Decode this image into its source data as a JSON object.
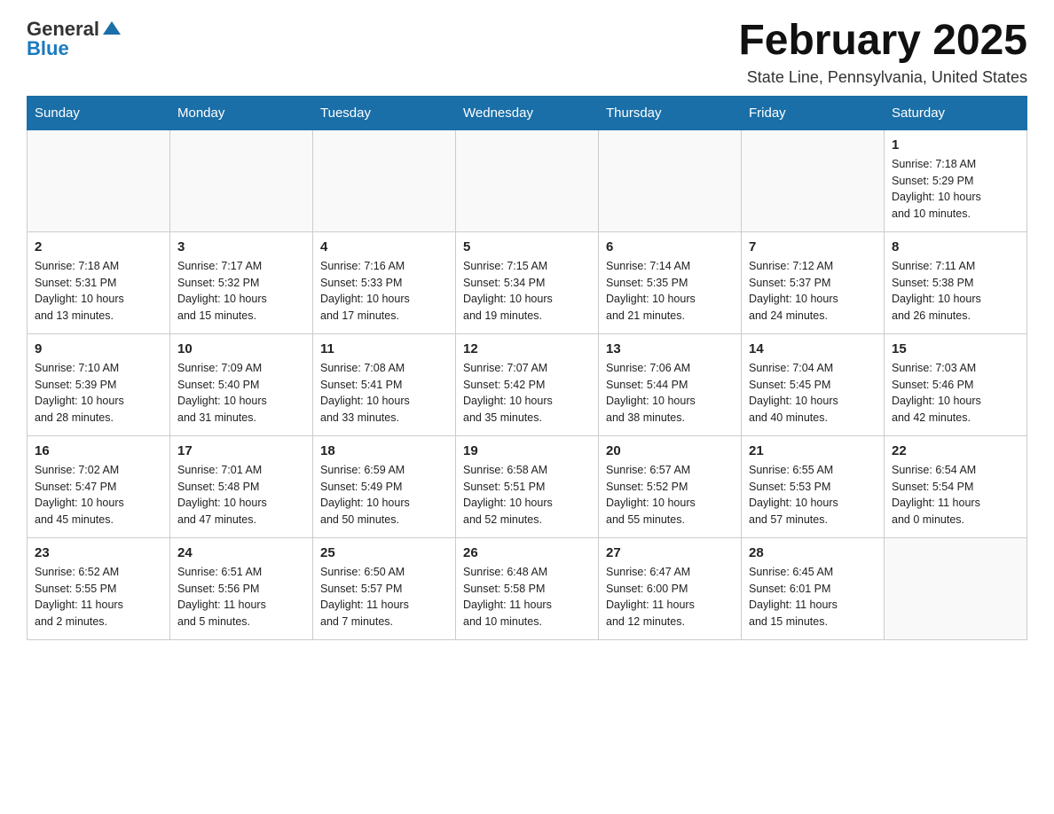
{
  "header": {
    "logo_general": "General",
    "logo_blue": "Blue",
    "title": "February 2025",
    "subtitle": "State Line, Pennsylvania, United States"
  },
  "weekdays": [
    "Sunday",
    "Monday",
    "Tuesday",
    "Wednesday",
    "Thursday",
    "Friday",
    "Saturday"
  ],
  "weeks": [
    [
      {
        "day": "",
        "info": ""
      },
      {
        "day": "",
        "info": ""
      },
      {
        "day": "",
        "info": ""
      },
      {
        "day": "",
        "info": ""
      },
      {
        "day": "",
        "info": ""
      },
      {
        "day": "",
        "info": ""
      },
      {
        "day": "1",
        "info": "Sunrise: 7:18 AM\nSunset: 5:29 PM\nDaylight: 10 hours\nand 10 minutes."
      }
    ],
    [
      {
        "day": "2",
        "info": "Sunrise: 7:18 AM\nSunset: 5:31 PM\nDaylight: 10 hours\nand 13 minutes."
      },
      {
        "day": "3",
        "info": "Sunrise: 7:17 AM\nSunset: 5:32 PM\nDaylight: 10 hours\nand 15 minutes."
      },
      {
        "day": "4",
        "info": "Sunrise: 7:16 AM\nSunset: 5:33 PM\nDaylight: 10 hours\nand 17 minutes."
      },
      {
        "day": "5",
        "info": "Sunrise: 7:15 AM\nSunset: 5:34 PM\nDaylight: 10 hours\nand 19 minutes."
      },
      {
        "day": "6",
        "info": "Sunrise: 7:14 AM\nSunset: 5:35 PM\nDaylight: 10 hours\nand 21 minutes."
      },
      {
        "day": "7",
        "info": "Sunrise: 7:12 AM\nSunset: 5:37 PM\nDaylight: 10 hours\nand 24 minutes."
      },
      {
        "day": "8",
        "info": "Sunrise: 7:11 AM\nSunset: 5:38 PM\nDaylight: 10 hours\nand 26 minutes."
      }
    ],
    [
      {
        "day": "9",
        "info": "Sunrise: 7:10 AM\nSunset: 5:39 PM\nDaylight: 10 hours\nand 28 minutes."
      },
      {
        "day": "10",
        "info": "Sunrise: 7:09 AM\nSunset: 5:40 PM\nDaylight: 10 hours\nand 31 minutes."
      },
      {
        "day": "11",
        "info": "Sunrise: 7:08 AM\nSunset: 5:41 PM\nDaylight: 10 hours\nand 33 minutes."
      },
      {
        "day": "12",
        "info": "Sunrise: 7:07 AM\nSunset: 5:42 PM\nDaylight: 10 hours\nand 35 minutes."
      },
      {
        "day": "13",
        "info": "Sunrise: 7:06 AM\nSunset: 5:44 PM\nDaylight: 10 hours\nand 38 minutes."
      },
      {
        "day": "14",
        "info": "Sunrise: 7:04 AM\nSunset: 5:45 PM\nDaylight: 10 hours\nand 40 minutes."
      },
      {
        "day": "15",
        "info": "Sunrise: 7:03 AM\nSunset: 5:46 PM\nDaylight: 10 hours\nand 42 minutes."
      }
    ],
    [
      {
        "day": "16",
        "info": "Sunrise: 7:02 AM\nSunset: 5:47 PM\nDaylight: 10 hours\nand 45 minutes."
      },
      {
        "day": "17",
        "info": "Sunrise: 7:01 AM\nSunset: 5:48 PM\nDaylight: 10 hours\nand 47 minutes."
      },
      {
        "day": "18",
        "info": "Sunrise: 6:59 AM\nSunset: 5:49 PM\nDaylight: 10 hours\nand 50 minutes."
      },
      {
        "day": "19",
        "info": "Sunrise: 6:58 AM\nSunset: 5:51 PM\nDaylight: 10 hours\nand 52 minutes."
      },
      {
        "day": "20",
        "info": "Sunrise: 6:57 AM\nSunset: 5:52 PM\nDaylight: 10 hours\nand 55 minutes."
      },
      {
        "day": "21",
        "info": "Sunrise: 6:55 AM\nSunset: 5:53 PM\nDaylight: 10 hours\nand 57 minutes."
      },
      {
        "day": "22",
        "info": "Sunrise: 6:54 AM\nSunset: 5:54 PM\nDaylight: 11 hours\nand 0 minutes."
      }
    ],
    [
      {
        "day": "23",
        "info": "Sunrise: 6:52 AM\nSunset: 5:55 PM\nDaylight: 11 hours\nand 2 minutes."
      },
      {
        "day": "24",
        "info": "Sunrise: 6:51 AM\nSunset: 5:56 PM\nDaylight: 11 hours\nand 5 minutes."
      },
      {
        "day": "25",
        "info": "Sunrise: 6:50 AM\nSunset: 5:57 PM\nDaylight: 11 hours\nand 7 minutes."
      },
      {
        "day": "26",
        "info": "Sunrise: 6:48 AM\nSunset: 5:58 PM\nDaylight: 11 hours\nand 10 minutes."
      },
      {
        "day": "27",
        "info": "Sunrise: 6:47 AM\nSunset: 6:00 PM\nDaylight: 11 hours\nand 12 minutes."
      },
      {
        "day": "28",
        "info": "Sunrise: 6:45 AM\nSunset: 6:01 PM\nDaylight: 11 hours\nand 15 minutes."
      },
      {
        "day": "",
        "info": ""
      }
    ]
  ]
}
